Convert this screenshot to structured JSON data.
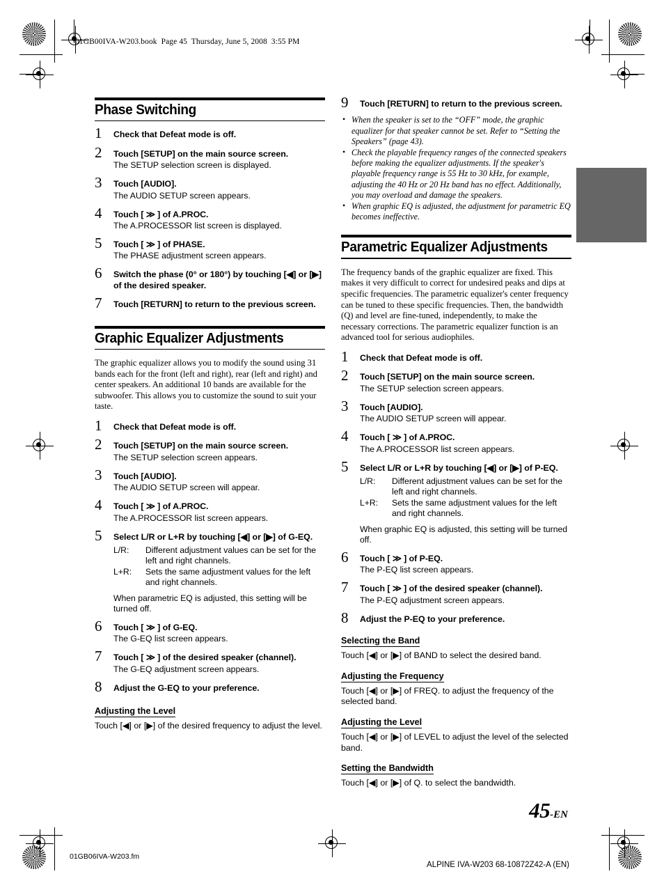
{
  "print_marks": {
    "header_code": "01GB00IVA-W203.book  Page 45  Thursday, June 5, 2008  3:55 PM",
    "footer_left": "01GB06IVA-W203.fm",
    "footer_right": "ALPINE IVA-W203 68-10872Z42-A (EN)"
  },
  "page_number": {
    "number": "45",
    "suffix": "-EN"
  },
  "glyphs": {
    "forward": "≫",
    "left": "◀",
    "right": "▶"
  },
  "colors": {
    "tab_marker": "#666666",
    "rule": "#000000"
  },
  "left_column": {
    "section1": {
      "title": "Phase Switching",
      "steps": [
        {
          "n": "1",
          "text": "Check that Defeat mode is off.",
          "desc": ""
        },
        {
          "n": "2",
          "text_pre": "Touch [",
          "bold_key": "SETUP",
          "text_post": "] on the main source screen.",
          "desc": "The SETUP selection screen is displayed."
        },
        {
          "n": "3",
          "text_pre": "Touch [",
          "bold_key": "AUDIO",
          "text_post": "].",
          "desc": "The AUDIO SETUP screen appears."
        },
        {
          "n": "4",
          "text_pre": "Touch [ ≫ ] of A.PROC.",
          "desc": "The A.PROCESSOR list screen is displayed."
        },
        {
          "n": "5",
          "text_pre": "Touch [ ≫ ] of PHASE.",
          "desc": "The PHASE adjustment screen appears."
        },
        {
          "n": "6",
          "text_pre": "Switch the phase (0° or 180°) by touching [◀] or [▶] of the desired speaker.",
          "desc": ""
        },
        {
          "n": "7",
          "text_pre": "Touch [",
          "bold_key": "RETURN",
          "text_post": "] to return to the previous screen.",
          "desc": ""
        }
      ]
    },
    "section2": {
      "title": "Graphic Equalizer Adjustments",
      "intro": "The graphic equalizer allows you to modify the sound using 31 bands each for the front (left and right), rear (left and right) and center speakers. An additional 10 bands are available for the subwoofer. This allows you to customize the sound to suit your taste.",
      "steps": [
        {
          "n": "1",
          "text": "Check that Defeat mode is off.",
          "desc": ""
        },
        {
          "n": "2",
          "text_pre": "Touch [",
          "bold_key": "SETUP",
          "text_post": "] on the main source screen.",
          "desc": "The SETUP selection screen appears."
        },
        {
          "n": "3",
          "text_pre": "Touch [",
          "bold_key": "AUDIO",
          "text_post": "].",
          "desc": "The AUDIO SETUP screen will appear."
        },
        {
          "n": "4",
          "text_pre": "Touch [ ≫ ] of A.PROC.",
          "desc": "The A.PROCESSOR list screen appears."
        },
        {
          "n": "5",
          "text_pre": "Select L/R or L+R by touching [◀] or [▶] of G-EQ.",
          "desc": ""
        },
        {
          "n": "6",
          "text_pre": "Touch [ ≫ ] of G-EQ.",
          "desc": "The G-EQ list screen appears."
        },
        {
          "n": "7",
          "text_pre": "Touch [ ≫ ] of the desired speaker (channel).",
          "desc": "The G-EQ adjustment screen appears."
        },
        {
          "n": "8",
          "text": "Adjust the G-EQ to your preference.",
          "desc": ""
        }
      ],
      "defs": [
        {
          "key": "L/R:",
          "value": "Different adjustment values can be set for the left and right channels."
        },
        {
          "key": "L+R:",
          "value": "Sets the same adjustment values for the left and right channels."
        }
      ],
      "def_note": "When parametric EQ is adjusted, this setting will be turned off.",
      "subsections": [
        {
          "heading": "Adjusting the Level",
          "body": "Touch [◀] or [▶] of the desired frequency to adjust the level."
        }
      ]
    }
  },
  "right_column": {
    "step9": {
      "n": "9",
      "text_pre": "Touch [",
      "bold_key": "RETURN",
      "text_post": "] to return to the previous screen."
    },
    "bullets": [
      "When the speaker is set to the “OFF” mode, the graphic equalizer for that speaker cannot be set. Refer to “Setting the Speakers” (page 43).",
      "Check the playable frequency ranges of the connected speakers before making the equalizer adjustments. If the speaker's playable frequency range is 55 Hz to 30 kHz, for example, adjusting the 40 Hz or 20 Hz band has no effect. Additionally, you may overload and damage the speakers.",
      "When graphic EQ is adjusted, the adjustment for parametric EQ becomes ineffective."
    ],
    "section3": {
      "title": "Parametric Equalizer Adjustments",
      "intro": "The frequency bands of the graphic equalizer are fixed. This makes it very difficult to correct for undesired peaks and dips at specific frequencies. The parametric equalizer's center frequency can be tuned to these specific frequencies. Then, the bandwidth (Q) and level are fine-tuned, independently, to make the necessary corrections. The parametric equalizer function is an advanced tool for serious audiophiles.",
      "steps": [
        {
          "n": "1",
          "text": "Check that Defeat mode is off.",
          "desc": ""
        },
        {
          "n": "2",
          "text_pre": "Touch [",
          "bold_key": "SETUP",
          "text_post": "] on the main source screen.",
          "desc": "The SETUP selection screen appears."
        },
        {
          "n": "3",
          "text_pre": "Touch [",
          "bold_key": "AUDIO",
          "text_post": "].",
          "desc": "The AUDIO SETUP screen will appear."
        },
        {
          "n": "4",
          "text_pre": "Touch [ ≫ ] of A.PROC.",
          "desc": "The A.PROCESSOR list screen appears."
        },
        {
          "n": "5",
          "text_pre": "Select L/R or L+R by touching [◀] or [▶] of P-EQ.",
          "desc": ""
        },
        {
          "n": "6",
          "text_pre": "Touch [ ≫ ] of P-EQ.",
          "desc": "The P-EQ list screen appears."
        },
        {
          "n": "7",
          "text_pre": "Touch [ ≫ ] of the desired speaker (channel).",
          "desc": "The P-EQ adjustment screen appears."
        },
        {
          "n": "8",
          "text": "Adjust the P-EQ to your preference.",
          "desc": ""
        }
      ],
      "defs": [
        {
          "key": "L/R:",
          "value": "Different adjustment values can be set for the left and right channels."
        },
        {
          "key": "L+R:",
          "value": "Sets the same adjustment values for the left and right channels."
        }
      ],
      "def_note": "When graphic EQ is adjusted, this setting will be turned off.",
      "subsections": [
        {
          "heading": "Selecting the Band",
          "body": "Touch [◀] or [▶] of BAND to select the desired band."
        },
        {
          "heading": "Adjusting the Frequency",
          "body": "Touch [◀] or [▶] of FREQ. to adjust the frequency of the selected band."
        },
        {
          "heading": "Adjusting the Level",
          "body": "Touch [◀] or [▶] of LEVEL to adjust the level of the selected band."
        },
        {
          "heading": "Setting the Bandwidth",
          "body": "Touch [◀] or [▶] of Q. to select the bandwidth."
        }
      ]
    }
  }
}
